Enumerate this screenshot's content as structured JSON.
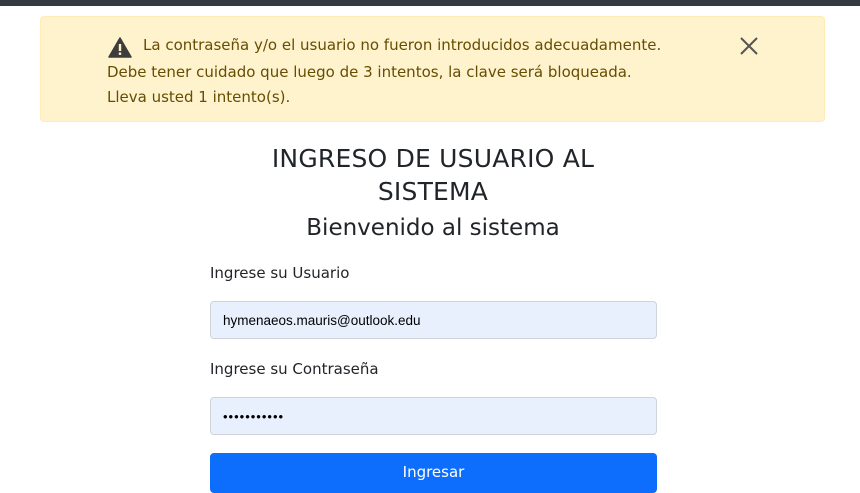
{
  "alert": {
    "type": "warning",
    "icon": "warning-triangle-icon",
    "close_icon": "close-icon",
    "line1": "La contraseña y/o el usuario no fueron introducidos adecuadamente.",
    "line2": "Debe tener cuidado que luego de 3 intentos, la clave será bloqueada.",
    "line3": "Lleva usted 1 intento(s).",
    "colors": {
      "background": "#fff3cd",
      "text": "#664d03"
    }
  },
  "header": {
    "title": "INGRESO DE USUARIO AL SISTEMA",
    "subtitle": "Bienvenido al sistema"
  },
  "form": {
    "user_label": "Ingrese su Usuario",
    "user_value": "hymenaeos.mauris@outlook.edu",
    "password_label": "Ingrese su Contraseña",
    "password_value": "•••••••••••",
    "submit_label": "Ingresar",
    "accent_color": "#0d6efd"
  }
}
